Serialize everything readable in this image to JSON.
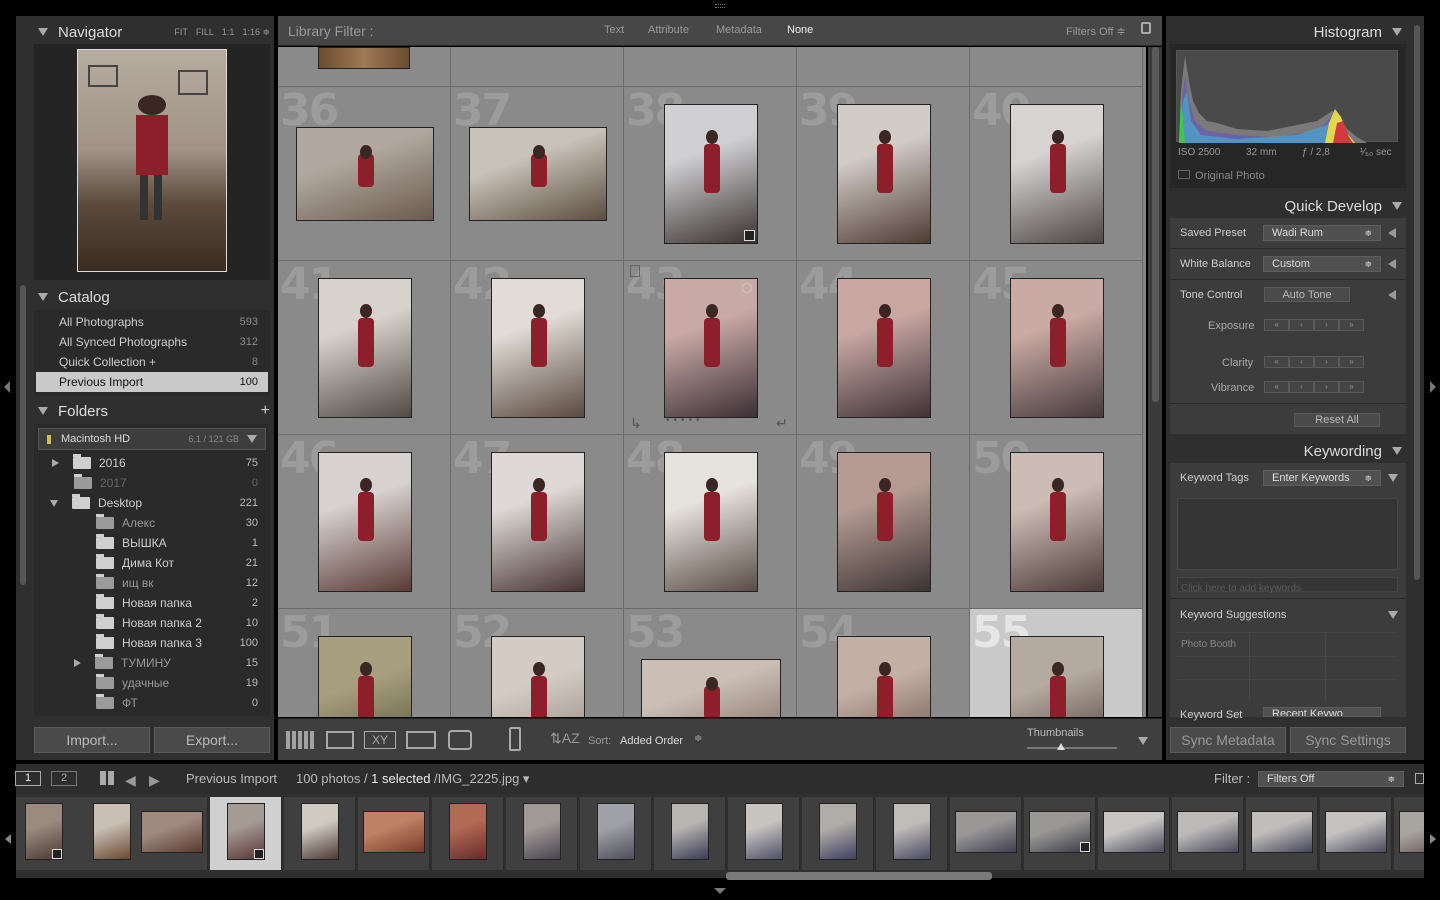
{
  "navigator": {
    "title": "Navigator",
    "zooms": [
      "FIT",
      "FILL",
      "1:1",
      "1:16 ≑"
    ]
  },
  "catalog": {
    "title": "Catalog",
    "items": [
      {
        "label": "All Photographs",
        "count": "593"
      },
      {
        "label": "All Synced Photographs",
        "count": "312"
      },
      {
        "label": "Quick Collection  +",
        "count": "8"
      },
      {
        "label": "Previous Import",
        "count": "100"
      }
    ]
  },
  "folders": {
    "title": "Folders",
    "volume": {
      "name": "Macintosh HD",
      "size": "6,1 / 121 GB"
    },
    "items": [
      {
        "label": "2016",
        "count": "75"
      },
      {
        "label": "2017",
        "count": "0"
      },
      {
        "label": "Desktop",
        "count": "221"
      },
      {
        "label": "Алекс",
        "count": "30"
      },
      {
        "label": "ВЫШКА",
        "count": "1"
      },
      {
        "label": "Дима Кот",
        "count": "21"
      },
      {
        "label": "ищ вк",
        "count": "12"
      },
      {
        "label": "Новая папка",
        "count": "2"
      },
      {
        "label": "Новая папка 2",
        "count": "10"
      },
      {
        "label": "Новая папка 3",
        "count": "100"
      },
      {
        "label": "ТУМИНУ",
        "count": "15"
      },
      {
        "label": "удачные",
        "count": "19"
      },
      {
        "label": "ФТ",
        "count": "0"
      }
    ]
  },
  "left_buttons": {
    "import": "Import...",
    "export": "Export..."
  },
  "filter_bar": {
    "label": "Library Filter :",
    "options": [
      "Text",
      "Attribute",
      "Metadata",
      "None"
    ],
    "status": "Filters Off ≑"
  },
  "grid": {
    "numbers": [
      "36",
      "37",
      "38",
      "39",
      "40",
      "41",
      "42",
      "43",
      "44",
      "45",
      "46",
      "47",
      "48",
      "49",
      "50",
      "51",
      "52",
      "53",
      "54",
      "55"
    ]
  },
  "toolbar": {
    "sort_label": "Sort:",
    "sort_value": "Added Order",
    "thumbnails_label": "Thumbnails"
  },
  "histogram": {
    "title": "Histogram",
    "iso": "ISO 2500",
    "focal": "32 mm",
    "aperture": "ƒ / 2,8",
    "shutter": "¹⁄₅₀ sec",
    "original": "Original Photo"
  },
  "quick_develop": {
    "title": "Quick Develop",
    "saved_preset_label": "Saved Preset",
    "saved_preset_value": "Wadi Rum",
    "wb_label": "White Balance",
    "wb_value": "Custom",
    "tone_label": "Tone Control",
    "auto_tone": "Auto Tone",
    "exposure": "Exposure",
    "clarity": "Clarity",
    "vibrance": "Vibrance",
    "reset": "Reset All"
  },
  "keywording": {
    "title": "Keywording",
    "tags_label": "Keyword Tags",
    "tags_value": "Enter Keywords",
    "add_placeholder": "Click here to add keywords",
    "suggestions_label": "Keyword Suggestions",
    "suggestion": "Photo Booth",
    "set_label": "Keyword Set",
    "set_value": "Recent Keywo"
  },
  "right_buttons": {
    "sync_metadata": "Sync Metadata",
    "sync_settings": "Sync Settings"
  },
  "filmstrip_bar": {
    "page1": "1",
    "page2": "2",
    "source": "Previous Import",
    "count": "100 photos / ",
    "selected": "1 selected",
    "file": " /IMG_2225.jpg ▾",
    "filter_label": "Filter :",
    "filter_value": "Filters Off"
  },
  "colors": {
    "accent_histogram_red": "#d23b3b",
    "accent_histogram_yellow": "#e2d84a",
    "dress_red": "#8c1f2a"
  }
}
